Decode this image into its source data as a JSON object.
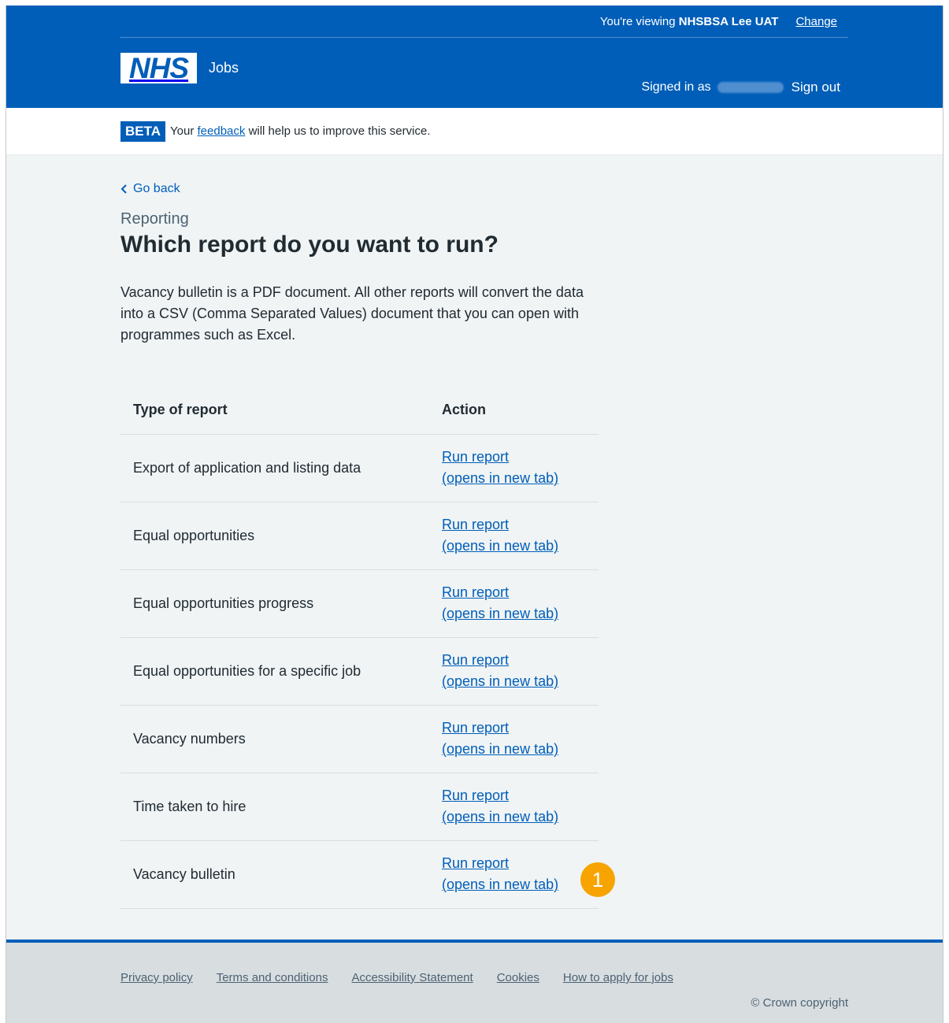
{
  "header": {
    "viewing_prefix": "You're viewing",
    "viewing_org": "NHSBSA Lee UAT",
    "change_label": "Change",
    "logo_text": "NHS",
    "service_name": "Jobs",
    "signed_in_label": "Signed in as",
    "sign_out_label": "Sign out"
  },
  "phase_banner": {
    "tag": "BETA",
    "text_before": "Your",
    "link": "feedback",
    "text_after": "will help us to improve this service."
  },
  "main": {
    "back_label": "Go back",
    "caption": "Reporting",
    "title": "Which report do you want to run?",
    "intro": "Vacancy bulletin is a PDF document. All other reports will convert the data into a CSV (Comma Separated Values) document that you can open with programmes such as Excel.",
    "table": {
      "headers": [
        "Type of report",
        "Action"
      ],
      "rows": [
        {
          "type": "Export of application and listing data",
          "action_line1": "Run report",
          "action_line2": "(opens in new tab)"
        },
        {
          "type": "Equal opportunities",
          "action_line1": "Run report",
          "action_line2": "(opens in new tab)"
        },
        {
          "type": "Equal opportunities progress",
          "action_line1": "Run report",
          "action_line2": "(opens in new tab)"
        },
        {
          "type": "Equal opportunities for a specific job",
          "action_line1": "Run report",
          "action_line2": "(opens in new tab)"
        },
        {
          "type": "Vacancy numbers",
          "action_line1": "Run report",
          "action_line2": "(opens in new tab)"
        },
        {
          "type": "Time taken to hire",
          "action_line1": "Run report",
          "action_line2": "(opens in new tab)"
        },
        {
          "type": "Vacancy bulletin",
          "action_line1": "Run report",
          "action_line2": "(opens in new tab)"
        }
      ]
    },
    "marker": "1"
  },
  "footer": {
    "links": [
      "Privacy policy",
      "Terms and conditions",
      "Accessibility Statement",
      "Cookies",
      "How to apply for jobs"
    ],
    "copyright": "© Crown copyright"
  },
  "colors": {
    "nhs_blue": "#005eb8",
    "marker": "#f7a400",
    "page_bg": "#f0f4f5"
  }
}
